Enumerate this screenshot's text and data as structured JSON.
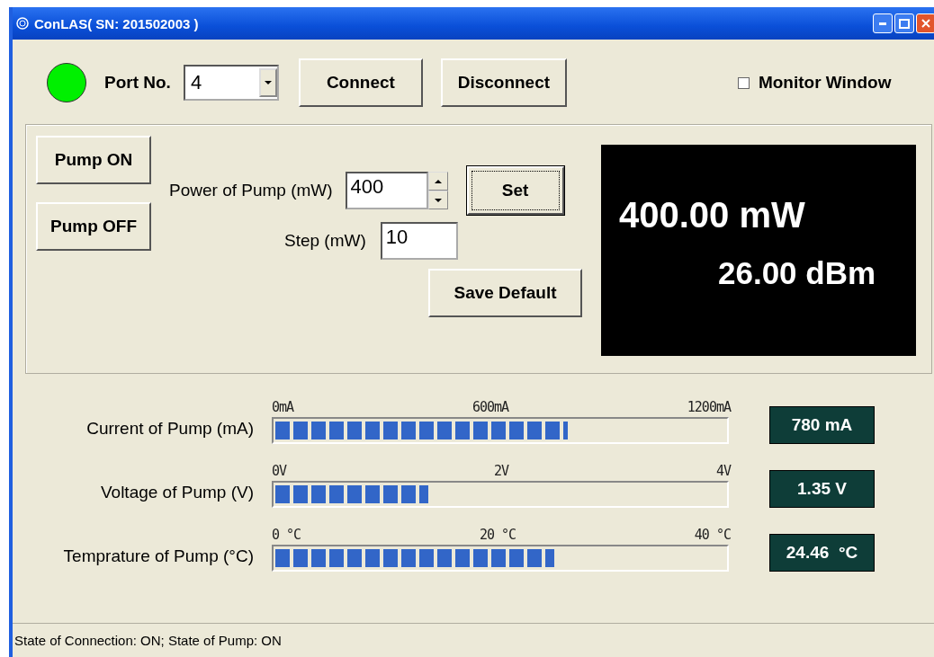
{
  "window": {
    "title": "ConLAS( SN: 201502003 )"
  },
  "connection": {
    "connected": true,
    "port_label": "Port No.",
    "port_value": "4",
    "buttons": [
      "Connect",
      "Disconnect"
    ],
    "monitor": {
      "label": "Monitor Window",
      "checked": false
    }
  },
  "pump": {
    "on_button": "Pump ON",
    "off_button": "Pump OFF",
    "power_label": "Power of Pump (mW)",
    "power_value": "400",
    "set_button": "Set",
    "step_label": "Step (mW)",
    "step_value": "10",
    "save_button": "Save Default",
    "display": {
      "power": "400.00 mW",
      "dbm": "26.00 dBm"
    }
  },
  "meters": [
    {
      "label": "Current of Pump (mA)",
      "ticks": [
        "0mA",
        "600mA",
        "1200mA"
      ],
      "level": 0.65,
      "reading": "780 mA"
    },
    {
      "label": "Voltage of Pump (V)",
      "ticks": [
        "0V",
        "2V",
        "4V"
      ],
      "level": 0.34,
      "reading": "1.35 V"
    },
    {
      "label": "Temprature of Pump (°C)",
      "ticks": [
        "0 °C",
        "20 °C",
        "40 °C"
      ],
      "level": 0.62,
      "reading": "24.46  °C"
    }
  ],
  "status_bar": "State of Connection: ON; State of Pump: ON"
}
